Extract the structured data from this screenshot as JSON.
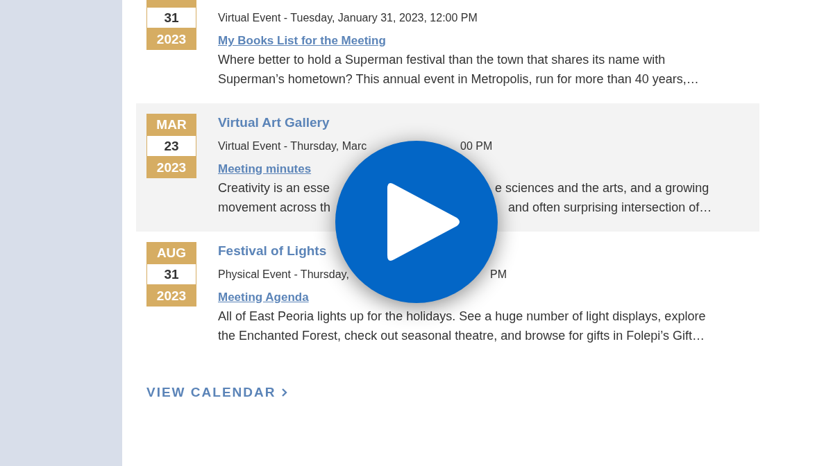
{
  "events": [
    {
      "day": "31",
      "year": "2023",
      "highlighted": false,
      "meta": [
        "Virtual Event - Tuesday, January 31, 2023, 12:00 PM"
      ],
      "link": "My Books List for the Meeting",
      "description": [
        [
          "Where better to hold a Superman festival than the town that shares its name with"
        ],
        [
          "Superman’s hometown? This annual event in Metropolis, run for more than 40 years,…"
        ]
      ]
    },
    {
      "month": "MAR",
      "day": "23",
      "year": "2023",
      "highlighted": true,
      "title": [
        "Virtual Art Gallery"
      ],
      "meta": [
        "Virtual Event - Thursday, Marc",
        "00 PM"
      ],
      "link": "Meeting minutes",
      "description": [
        [
          "Creativity is an esse",
          "e sciences and the arts, and a growing"
        ],
        [
          "movement across th",
          "and often surprising intersection of…"
        ]
      ]
    },
    {
      "month": "AUG",
      "day": "31",
      "year": "2023",
      "highlighted": false,
      "title": [
        "Festival of Lights"
      ],
      "meta": [
        "Physical Event - Thursday,",
        "PM"
      ],
      "link": "Meeting Agenda",
      "description": [
        [
          "All of East Peoria lights up for the holidays. See a huge number of light displays, explore"
        ],
        [
          "the Enchanted Forest, check out seasonal theatre, and browse for gifts in Folepi’s Gift…"
        ]
      ]
    }
  ],
  "view_calendar": "VIEW CALENDAR"
}
